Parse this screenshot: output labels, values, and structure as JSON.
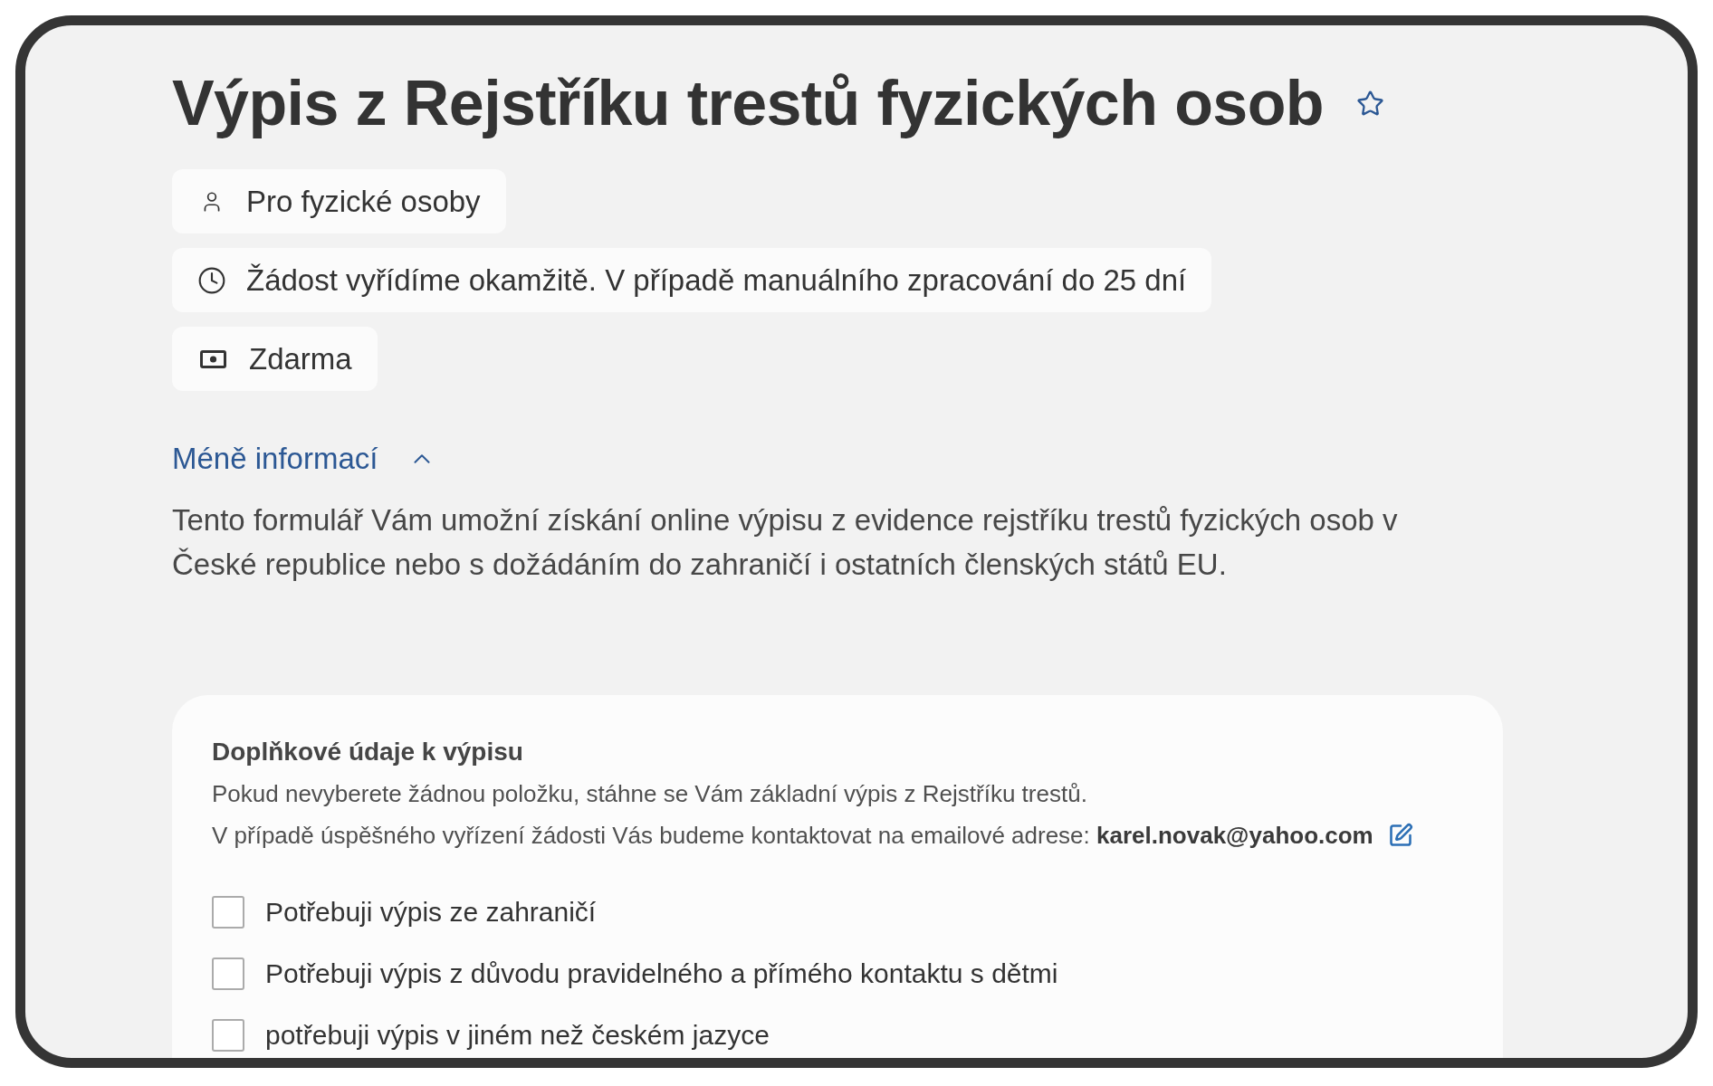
{
  "title": "Výpis z Rejstříku trestů fyzických osob",
  "starred": false,
  "info_chips": [
    {
      "kind": "audience",
      "text": "Pro fyzické osoby"
    },
    {
      "kind": "time",
      "text": "Žádost vyřídíme okamžitě. V případě manuálního zpracování do 25 dní"
    },
    {
      "kind": "price",
      "text": "Zdarma"
    }
  ],
  "details_toggle": {
    "label": "Méně informací",
    "expanded": true
  },
  "description": "Tento formulář Vám umožní získání online výpisu z evidence rejstříku trestů fyzických osob v České republice nebo s dožádáním do zahraničí i ostatních členských států EU.",
  "form_card": {
    "title": "Doplňkové údaje k výpisu",
    "note": "Pokud nevyberete žádnou položku, stáhne se Vám základní výpis z Rejstříku trestů.",
    "contact_note": "V případě úspěšného vyřízení žádosti Vás budeme kontaktovat na emailové adrese: **karel.novak@yahoo.com**",
    "options": [
      {
        "label": "Potřebuji výpis ze zahraničí",
        "checked": false
      },
      {
        "label": "Potřebuji výpis z důvodu pravidelného a přímého kontaktu s dětmi",
        "checked": false
      },
      {
        "label": "potřebuji výpis v jiném než českém jazyce",
        "checked": false
      }
    ]
  }
}
